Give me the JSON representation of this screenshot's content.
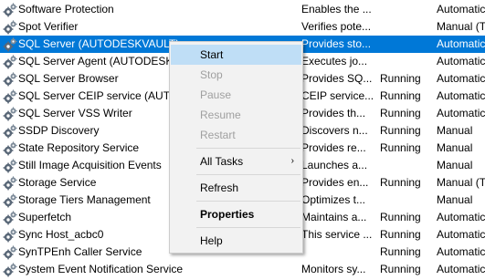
{
  "services": [
    {
      "name": "Software Protection",
      "description": "Enables the ...",
      "status": "",
      "startup": "Automatic"
    },
    {
      "name": "Spot Verifier",
      "description": "Verifies pote...",
      "status": "",
      "startup": "Manual (T"
    },
    {
      "name": "SQL Server (AUTODESKVAULT)",
      "description": "Provides sto...",
      "status": "",
      "startup": "Automatic",
      "selected": true
    },
    {
      "name": "SQL Server Agent (AUTODESKVAULT)",
      "description": "Executes jo...",
      "status": "",
      "startup": "Automatic"
    },
    {
      "name": "SQL Server Browser",
      "description": "Provides SQ...",
      "status": "Running",
      "startup": "Automatic"
    },
    {
      "name": "SQL Server CEIP service (AUTODESKVAULT)",
      "description": "CEIP service...",
      "status": "Running",
      "startup": "Automatic"
    },
    {
      "name": "SQL Server VSS Writer",
      "description": "Provides th...",
      "status": "Running",
      "startup": "Automatic"
    },
    {
      "name": "SSDP Discovery",
      "description": "Discovers n...",
      "status": "Running",
      "startup": "Manual"
    },
    {
      "name": "State Repository Service",
      "description": "Provides re...",
      "status": "Running",
      "startup": "Manual"
    },
    {
      "name": "Still Image Acquisition Events",
      "description": "Launches a...",
      "status": "",
      "startup": "Manual"
    },
    {
      "name": "Storage Service",
      "description": "Provides en...",
      "status": "Running",
      "startup": "Manual (T"
    },
    {
      "name": "Storage Tiers Management",
      "description": "Optimizes t...",
      "status": "",
      "startup": "Manual"
    },
    {
      "name": "Superfetch",
      "description": "Maintains a...",
      "status": "Running",
      "startup": "Automatic"
    },
    {
      "name": "Sync Host_acbc0",
      "description": "This service ...",
      "status": "Running",
      "startup": "Automatic"
    },
    {
      "name": "SynTPEnh Caller Service",
      "description": "",
      "status": "Running",
      "startup": "Automatic"
    },
    {
      "name": "System Event Notification Service",
      "description": "Monitors sy...",
      "status": "Running",
      "startup": "Automatic"
    }
  ],
  "context_menu": {
    "start": "Start",
    "stop": "Stop",
    "pause": "Pause",
    "resume": "Resume",
    "restart": "Restart",
    "all_tasks": "All Tasks",
    "refresh": "Refresh",
    "properties": "Properties",
    "help": "Help",
    "submenu_arrow": "›"
  },
  "colors": {
    "selection": "#0078d7",
    "menu_highlight": "#bfdef6",
    "disabled_text": "#a0a0a0"
  },
  "icons": {
    "service": "gear-icon"
  }
}
